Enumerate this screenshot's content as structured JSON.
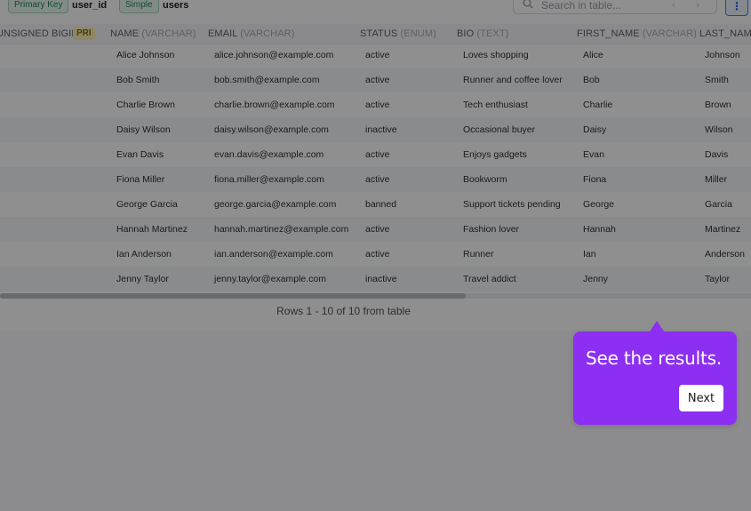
{
  "topbar": {
    "primary_key_label": "Primary Key",
    "primary_key_value": "user_id",
    "simple_label": "Simple",
    "table_name": "users",
    "search_placeholder": "Search in table...",
    "menu_glyph": "⋮"
  },
  "columns": [
    {
      "name": "UNSIGNED BIGINT)",
      "type": "",
      "pri": "PRI"
    },
    {
      "name": "NAME",
      "type": "(VARCHAR)"
    },
    {
      "name": "EMAIL",
      "type": "(VARCHAR)"
    },
    {
      "name": "STATUS",
      "type": "(ENUM)"
    },
    {
      "name": "BIO",
      "type": "(TEXT)"
    },
    {
      "name": "FIRST_NAME",
      "type": "(VARCHAR)"
    },
    {
      "name": "LAST_NAME",
      "type": ""
    }
  ],
  "rows": [
    {
      "name": "Alice Johnson",
      "email": "alice.johnson@example.com",
      "status": "active",
      "bio": "Loves shopping",
      "first": "Alice",
      "last": "Johnson"
    },
    {
      "name": "Bob Smith",
      "email": "bob.smith@example.com",
      "status": "active",
      "bio": "Runner and coffee lover",
      "first": "Bob",
      "last": "Smith"
    },
    {
      "name": "Charlie Brown",
      "email": "charlie.brown@example.com",
      "status": "active",
      "bio": "Tech enthusiast",
      "first": "Charlie",
      "last": "Brown"
    },
    {
      "name": "Daisy Wilson",
      "email": "daisy.wilson@example.com",
      "status": "inactive",
      "bio": "Occasional buyer",
      "first": "Daisy",
      "last": "Wilson"
    },
    {
      "name": "Evan Davis",
      "email": "evan.davis@example.com",
      "status": "active",
      "bio": "Enjoys gadgets",
      "first": "Evan",
      "last": "Davis"
    },
    {
      "name": "Fiona Miller",
      "email": "fiona.miller@example.com",
      "status": "active",
      "bio": "Bookworm",
      "first": "Fiona",
      "last": "Miller"
    },
    {
      "name": "George Garcia",
      "email": "george.garcia@example.com",
      "status": "banned",
      "bio": "Support tickets pending",
      "first": "George",
      "last": "Garcia"
    },
    {
      "name": "Hannah Martinez",
      "email": "hannah.martinez@example.com",
      "status": "active",
      "bio": "Fashion lover",
      "first": "Hannah",
      "last": "Martinez"
    },
    {
      "name": "Ian Anderson",
      "email": "ian.anderson@example.com",
      "status": "active",
      "bio": "Runner",
      "first": "Ian",
      "last": "Anderson"
    },
    {
      "name": "Jenny Taylor",
      "email": "jenny.taylor@example.com",
      "status": "inactive",
      "bio": "Travel addict",
      "first": "Jenny",
      "last": "Taylor"
    }
  ],
  "footer": "Rows 1 - 10 of 10 from table",
  "scroll_progress": 0.62,
  "tooltip": {
    "message": "See the results.",
    "next_label": "Next",
    "color": "#8c2ff2"
  }
}
